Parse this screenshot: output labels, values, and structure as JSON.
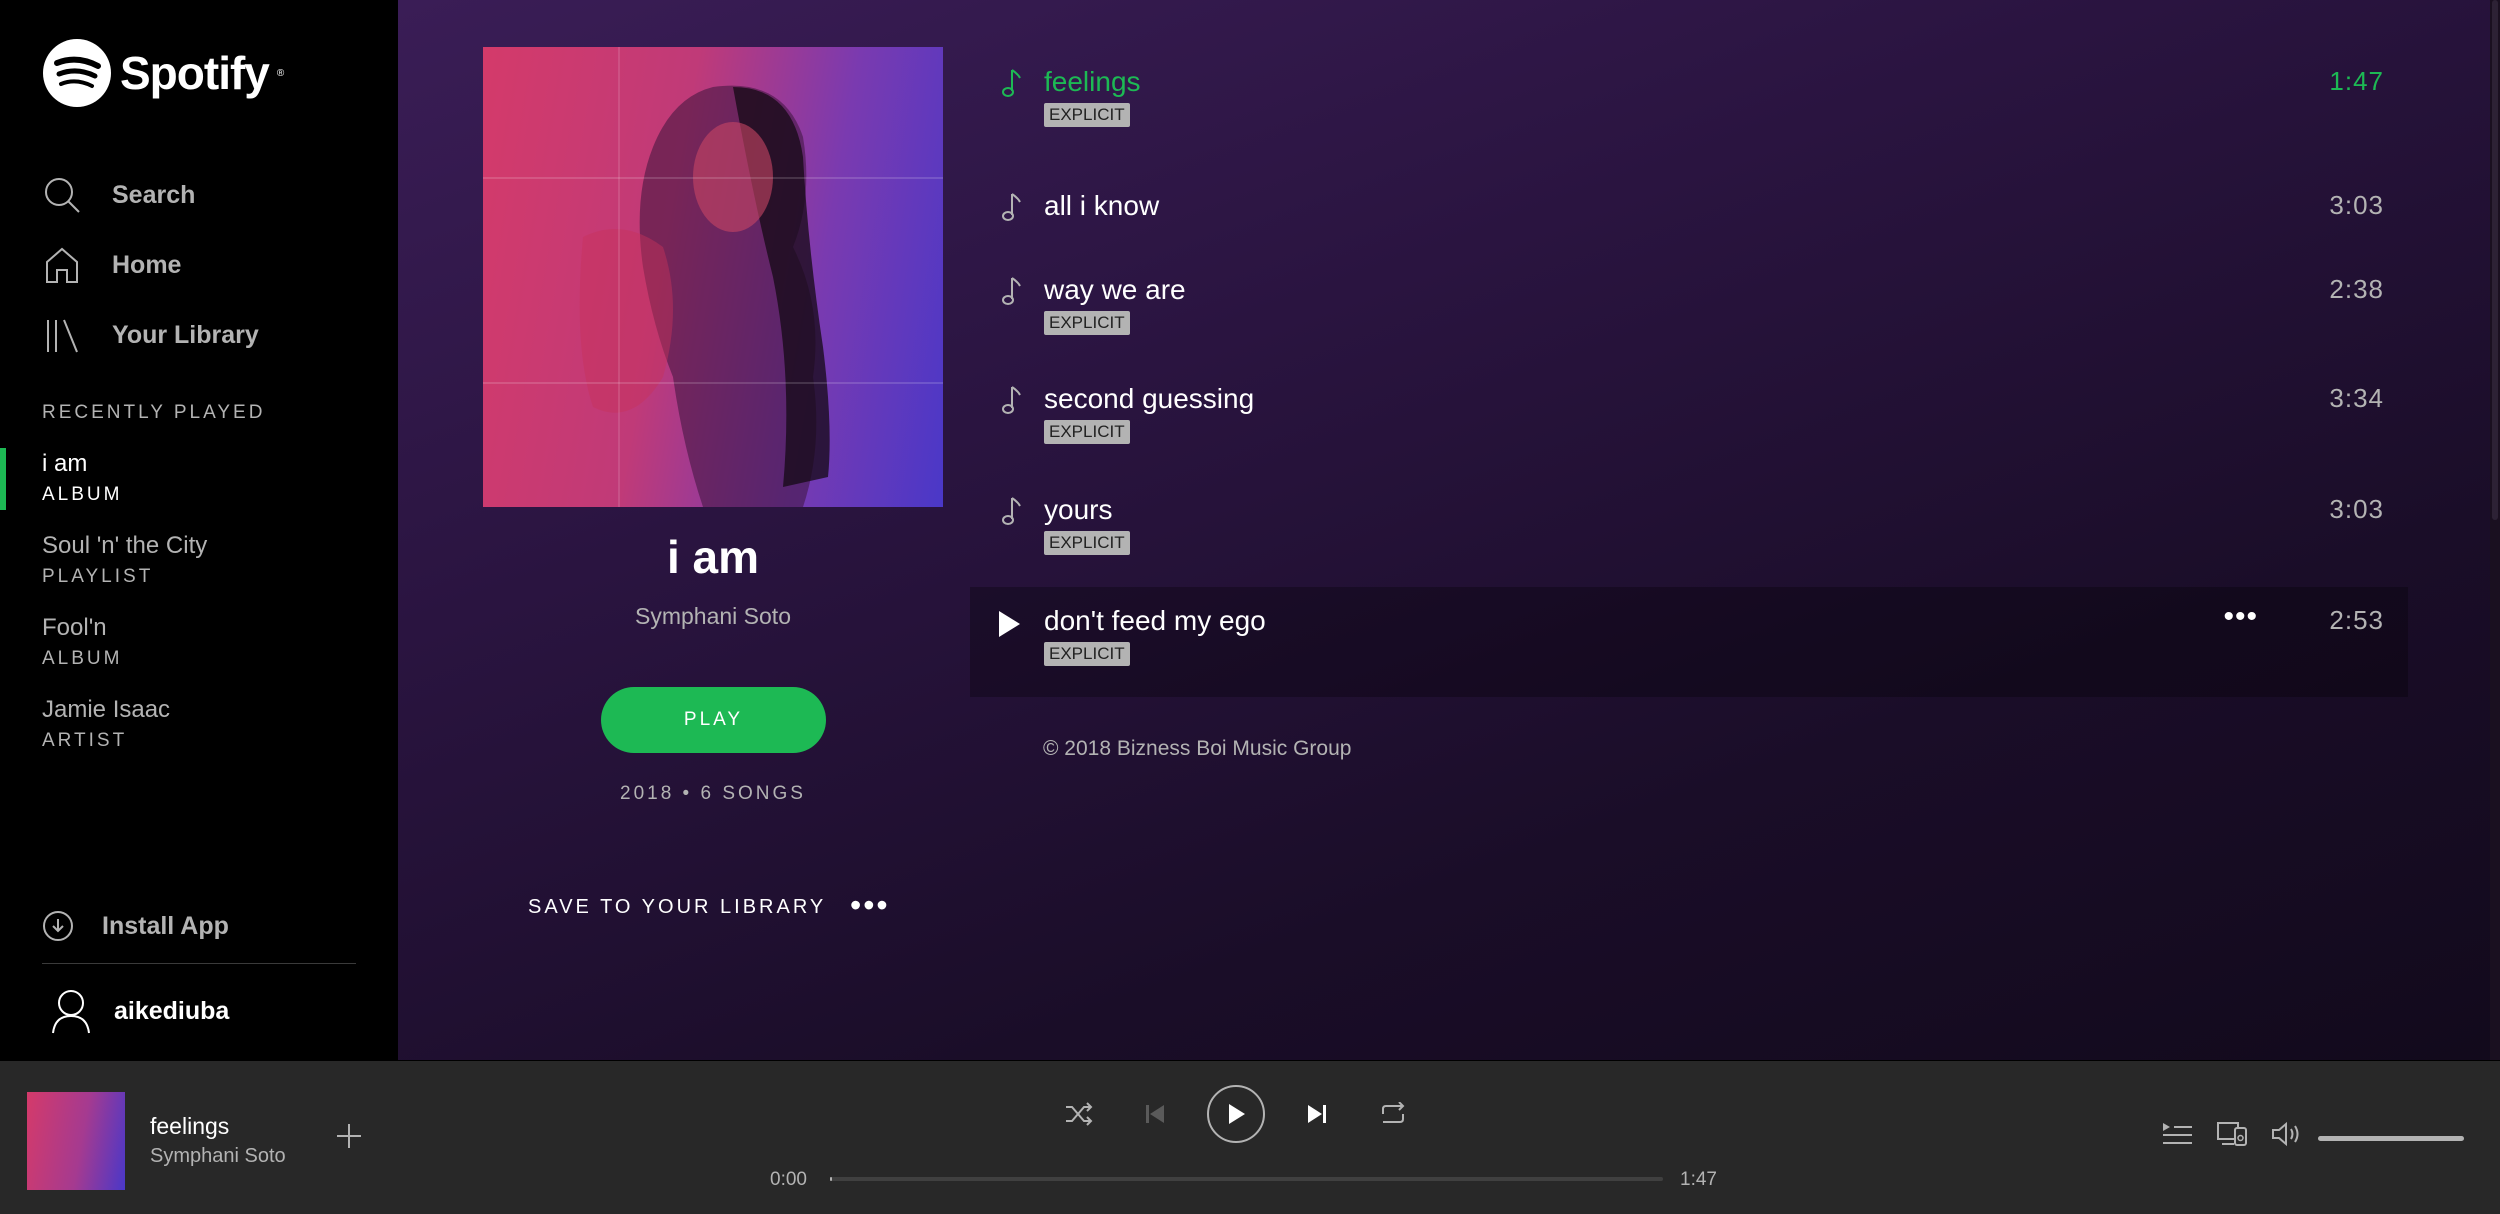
{
  "brand": {
    "name": "Spotify"
  },
  "nav": [
    {
      "label": "Search",
      "icon": "search-icon"
    },
    {
      "label": "Home",
      "icon": "home-icon"
    },
    {
      "label": "Your Library",
      "icon": "library-icon"
    }
  ],
  "recently_played": {
    "heading": "RECENTLY PLAYED",
    "items": [
      {
        "title": "i am",
        "type": "ALBUM",
        "active": true
      },
      {
        "title": "Soul 'n' the City",
        "type": "PLAYLIST",
        "active": false
      },
      {
        "title": "Fool'n",
        "type": "ALBUM",
        "active": false
      },
      {
        "title": "Jamie Isaac",
        "type": "ARTIST",
        "active": false
      }
    ]
  },
  "install_app": "Install App",
  "user": {
    "name": "aikediuba"
  },
  "album": {
    "title": "i am",
    "artist": "Symphani Soto",
    "play_label": "PLAY",
    "meta": "2018 • 6 SONGS",
    "save_label": "SAVE TO YOUR LIBRARY",
    "more_label": "•••",
    "copyright": "© 2018 Bizness Boi Music Group"
  },
  "tracks": [
    {
      "title": "feelings",
      "explicit": "EXPLICIT",
      "duration": "1:47",
      "state": "playing"
    },
    {
      "title": "all i know",
      "explicit": "",
      "duration": "3:03",
      "state": ""
    },
    {
      "title": "way we are",
      "explicit": "EXPLICIT",
      "duration": "2:38",
      "state": ""
    },
    {
      "title": "second guessing",
      "explicit": "EXPLICIT",
      "duration": "3:34",
      "state": ""
    },
    {
      "title": "yours",
      "explicit": "EXPLICIT",
      "duration": "3:03",
      "state": ""
    },
    {
      "title": "don't feed my ego",
      "explicit": "EXPLICIT",
      "duration": "2:53",
      "state": "hovered",
      "more": "•••"
    }
  ],
  "player": {
    "track": "feelings",
    "artist": "Symphani Soto",
    "current_time": "0:00",
    "total_time": "1:47",
    "progress_fraction": 0.0,
    "volume_fraction": 1.0
  },
  "colors": {
    "accent": "#1db954",
    "sidebar": "#000000",
    "player_bar": "#282828",
    "muted_text": "#b3b3b3"
  }
}
